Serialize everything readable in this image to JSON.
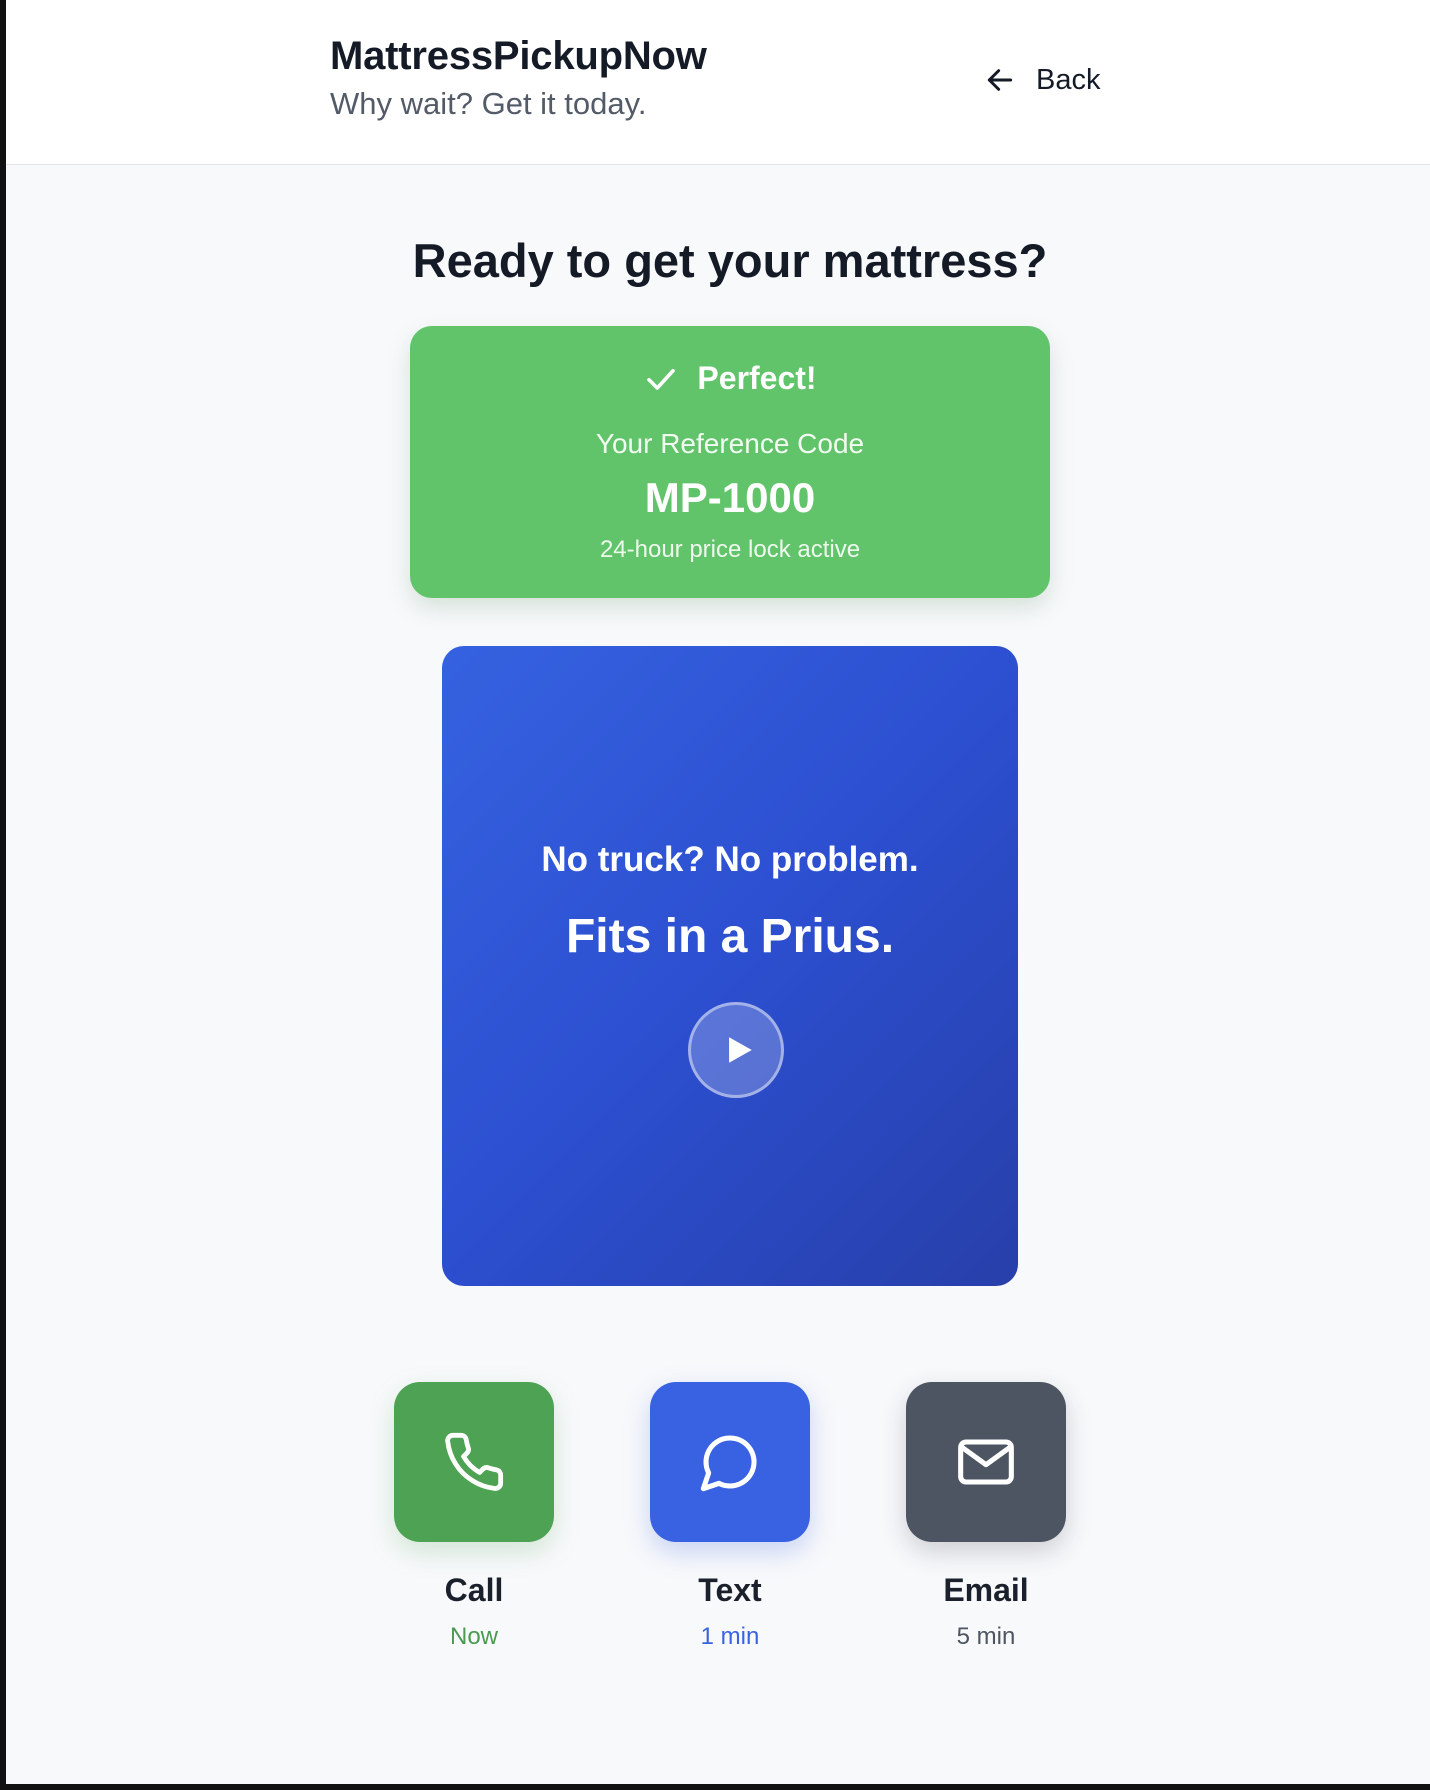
{
  "header": {
    "brand_title": "MattressPickupNow",
    "tagline": "Why wait? Get it today.",
    "back_label": "Back"
  },
  "main": {
    "headline": "Ready to get your mattress?",
    "confirmation": {
      "title": "Perfect!",
      "reference_label": "Your Reference Code",
      "reference_code": "MP-1000",
      "note": "24-hour price lock active",
      "color": "#62c46a"
    },
    "promo": {
      "line1": "No truck? No problem.",
      "line2": "Fits in a Prius.",
      "icon": "play-icon"
    },
    "contact_options": [
      {
        "label": "Call",
        "eta": "Now",
        "icon": "phone-icon",
        "color": "#4ea253"
      },
      {
        "label": "Text",
        "eta": "1 min",
        "icon": "chat-bubble-icon",
        "color": "#3862e2"
      },
      {
        "label": "Email",
        "eta": "5 min",
        "icon": "mail-icon",
        "color": "#4d5563"
      }
    ]
  }
}
